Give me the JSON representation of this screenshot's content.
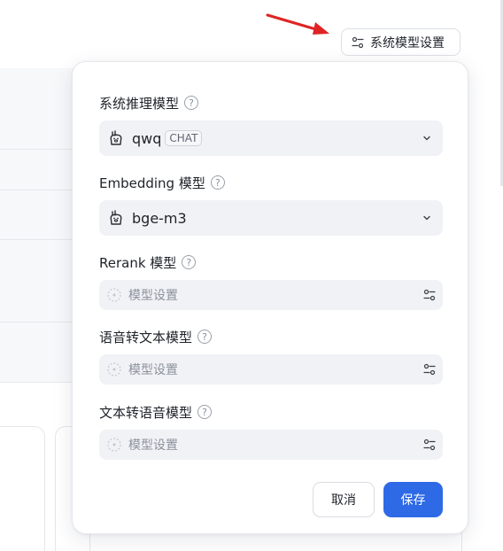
{
  "header": {
    "settings_button_label": "系统模型设置",
    "settings_icon": "tune-icon"
  },
  "popover": {
    "fields": [
      {
        "label": "系统推理模型",
        "value": "qwq",
        "tag": "CHAT",
        "icon": "llama-icon"
      },
      {
        "label": "Embedding 模型",
        "value": "bge-m3",
        "icon": "llama-icon"
      },
      {
        "label": "Rerank 模型",
        "placeholder": "模型设置"
      },
      {
        "label": "语音转文本模型",
        "placeholder": "模型设置"
      },
      {
        "label": "文本转语音模型",
        "placeholder": "模型设置"
      }
    ],
    "help_glyph": "?",
    "cancel_label": "取消",
    "save_label": "保存"
  },
  "colors": {
    "accent": "#2e6ae6",
    "arrow": "#e02424",
    "field_bg": "#f1f2f6"
  }
}
